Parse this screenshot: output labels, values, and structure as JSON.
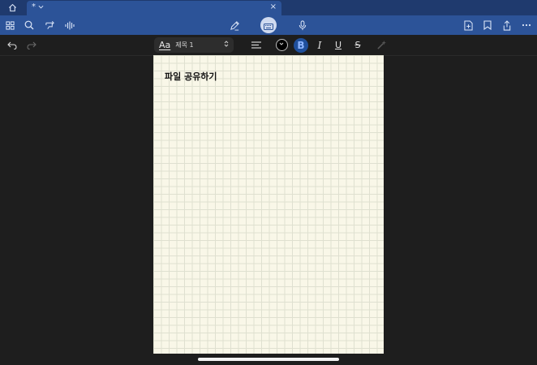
{
  "tabs": {
    "doc_title": "*",
    "close": "×"
  },
  "toolbar": {
    "left_icons": [
      "grid-icon",
      "search-icon",
      "lasso-icon",
      "audio-wave-icon"
    ],
    "center_icons": [
      "pen-icon",
      "keyboard-icon",
      "microphone-icon"
    ],
    "right_icons": [
      "add-page-icon",
      "bookmark-icon",
      "share-icon",
      "more-icon"
    ]
  },
  "format": {
    "style_aa": "Aa",
    "style_name": "제목 1",
    "bold": "B",
    "italic": "I",
    "underline": "U",
    "strike": "S",
    "text_color": "#000000",
    "accent": "#2c5398"
  },
  "document": {
    "heading": "파일 공유하기"
  }
}
